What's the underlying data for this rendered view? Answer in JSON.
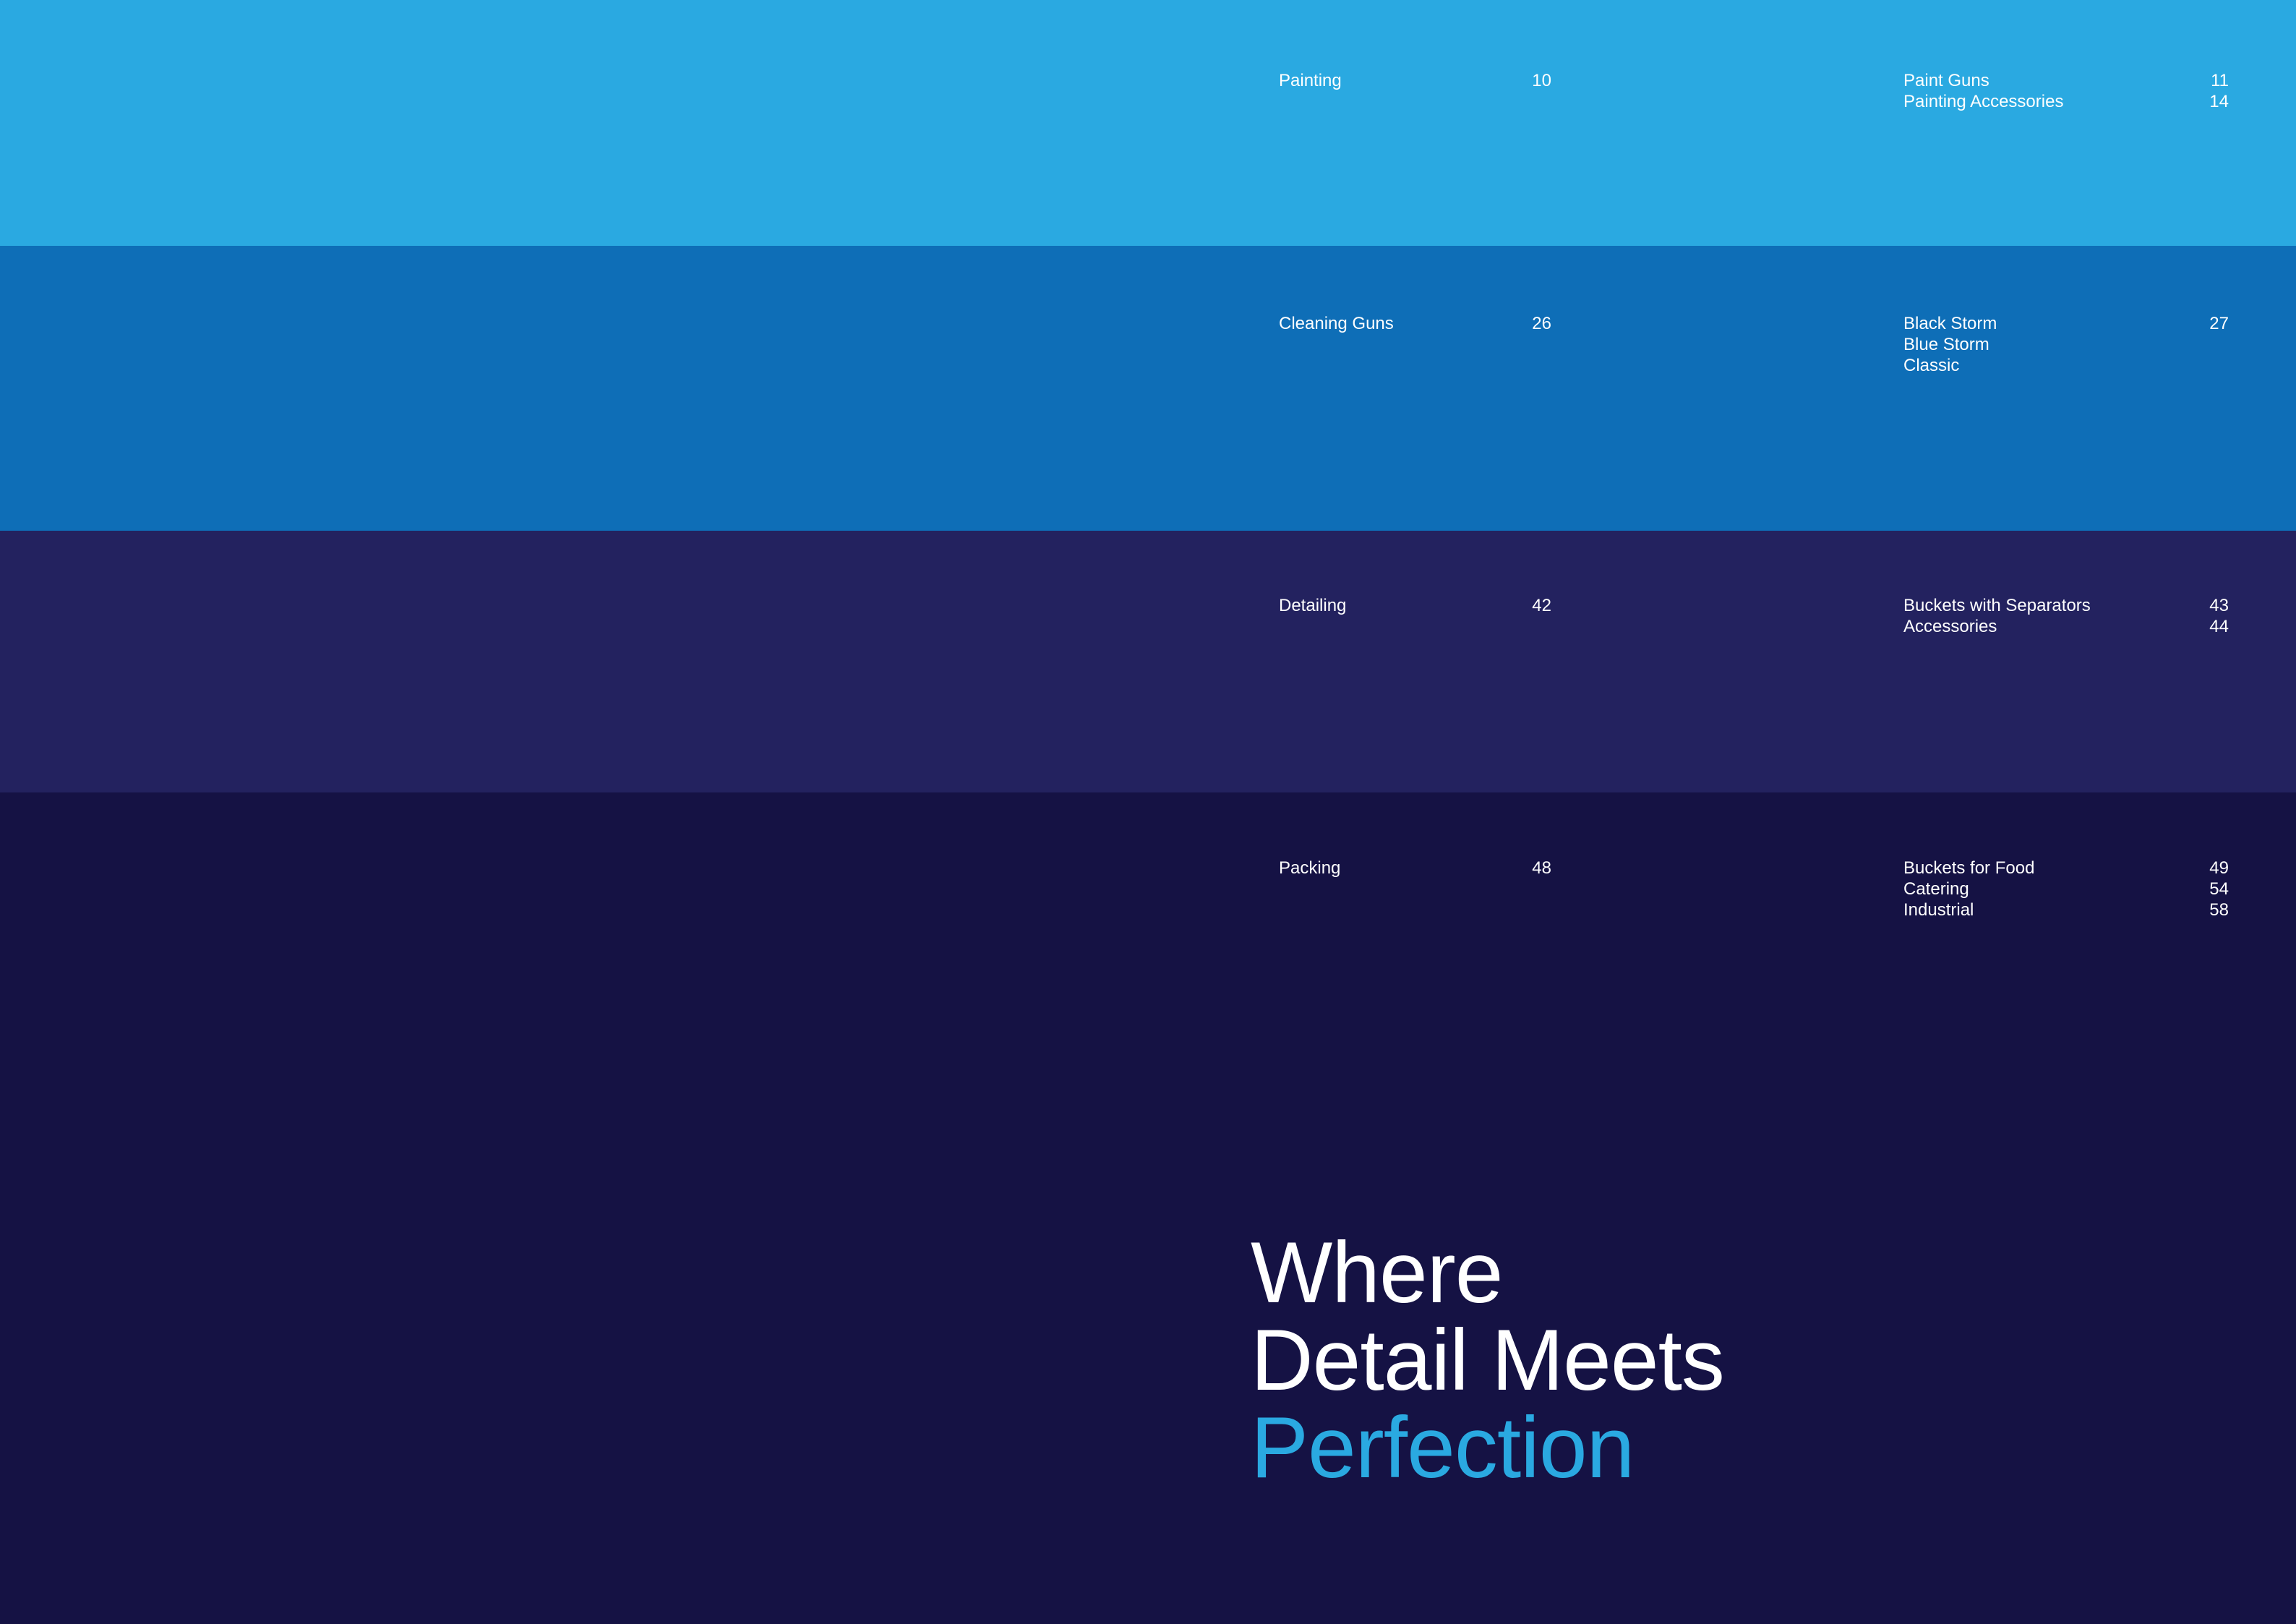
{
  "colors": {
    "painting_band": "#2aa9e1",
    "cleaning_band": "#0e6eb7",
    "detailing_band": "#23225f",
    "packing_band": "#151244",
    "text": "#ffffff",
    "accent": "#2aa9e1"
  },
  "sections": [
    {
      "label": "Painting",
      "page": "10",
      "items": [
        {
          "label": "Paint Guns",
          "page": "11"
        },
        {
          "label": "Painting Accessories",
          "page": "14"
        }
      ]
    },
    {
      "label": "Cleaning Guns",
      "page": "26",
      "items": [
        {
          "label": "Black Storm",
          "page": "27"
        },
        {
          "label": "Blue Storm",
          "page": ""
        },
        {
          "label": "Classic",
          "page": ""
        }
      ]
    },
    {
      "label": "Detailing",
      "page": "42",
      "items": [
        {
          "label": "Buckets with Separators",
          "page": "43"
        },
        {
          "label": "Accessories",
          "page": "44"
        }
      ]
    },
    {
      "label": "Packing",
      "page": "48",
      "items": [
        {
          "label": "Buckets for Food",
          "page": "49"
        },
        {
          "label": "Catering",
          "page": "54"
        },
        {
          "label": "Industrial",
          "page": "58"
        }
      ]
    }
  ],
  "headline": {
    "line1": "Where",
    "line2": "Detail Meets",
    "line3": "Perfection"
  }
}
